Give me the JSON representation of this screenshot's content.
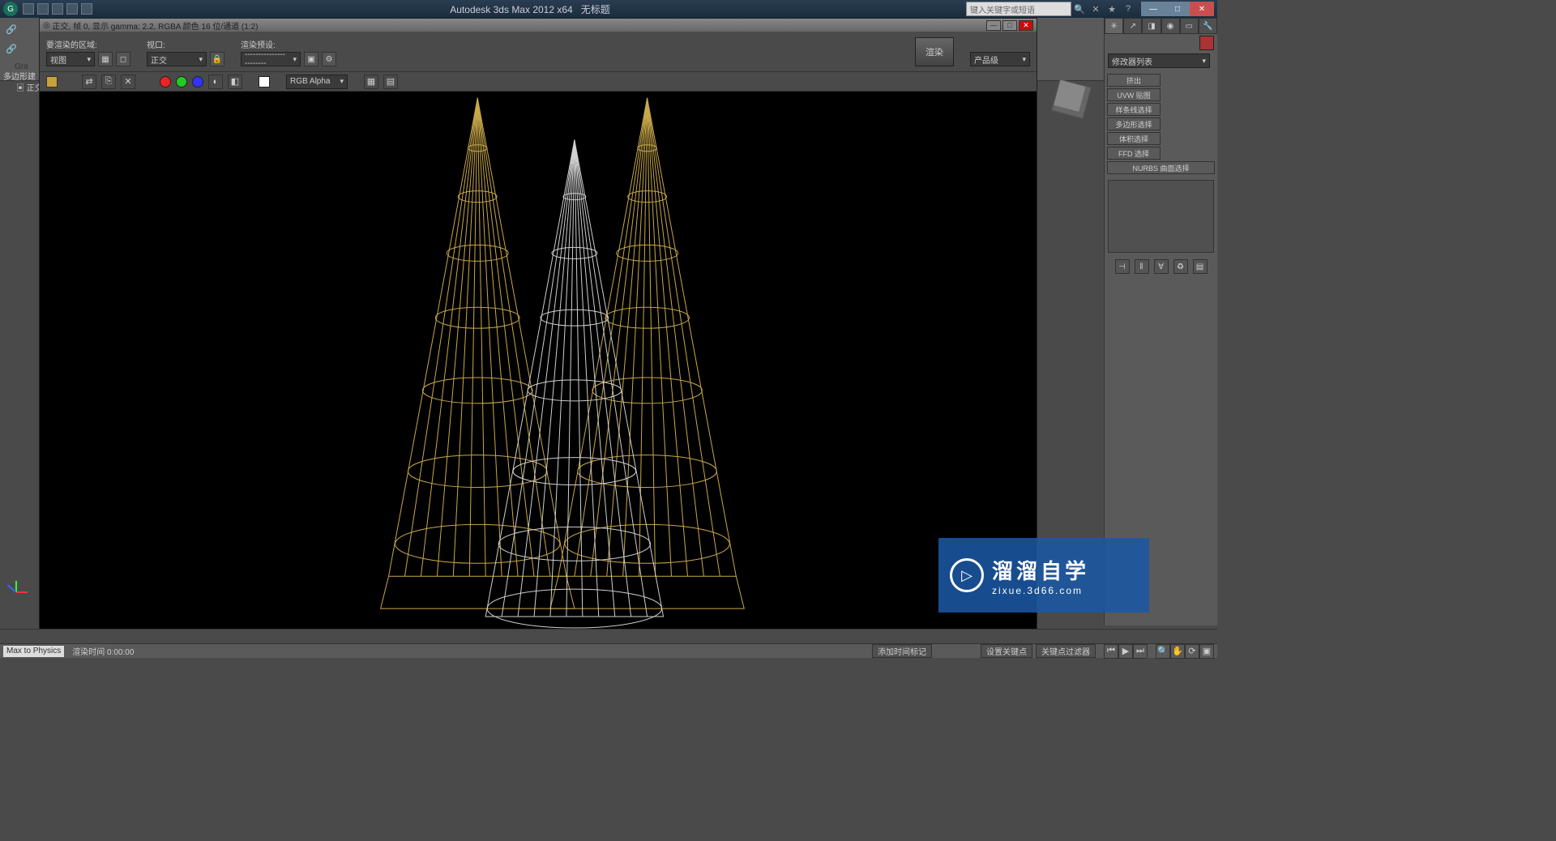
{
  "app": {
    "title": "Autodesk 3ds Max  2012 x64",
    "doc": "无标题",
    "search_placeholder": "键入关键字或短语"
  },
  "render_window": {
    "title": "正交, 帧 0, 显示 gamma: 2.2, RGBA 颜色 16 位/通道 (1:2)",
    "area_label": "要渲染的区域:",
    "area_value": "视图",
    "viewport_label": "视口:",
    "viewport_value": "正交",
    "preset_label": "渲染预设:",
    "preset_value": "-----------------------",
    "render_button": "渲染",
    "output_label": "产品级",
    "rgb_label": "RGB Alpha"
  },
  "toolbar": {
    "gra_label": "Gra",
    "poly_label": "多边形建",
    "ortho_tab": "正交"
  },
  "command_panel": {
    "modifier_list": "修改器列表",
    "buttons": [
      "挤出",
      "UVW 贴图",
      "样条线选择",
      "多边形选择",
      "体积选择",
      "FFD 选择",
      "NURBS 曲面选择"
    ]
  },
  "status": {
    "physics": "Max to Physics",
    "render_time": "渲染时间 0:00:00",
    "add_time_marker": "添加时间标记",
    "set_key": "设置关键点",
    "key_filter": "关键点过滤器"
  },
  "watermark": {
    "main": "溜溜自学",
    "sub": "zixue.3d66.com"
  }
}
